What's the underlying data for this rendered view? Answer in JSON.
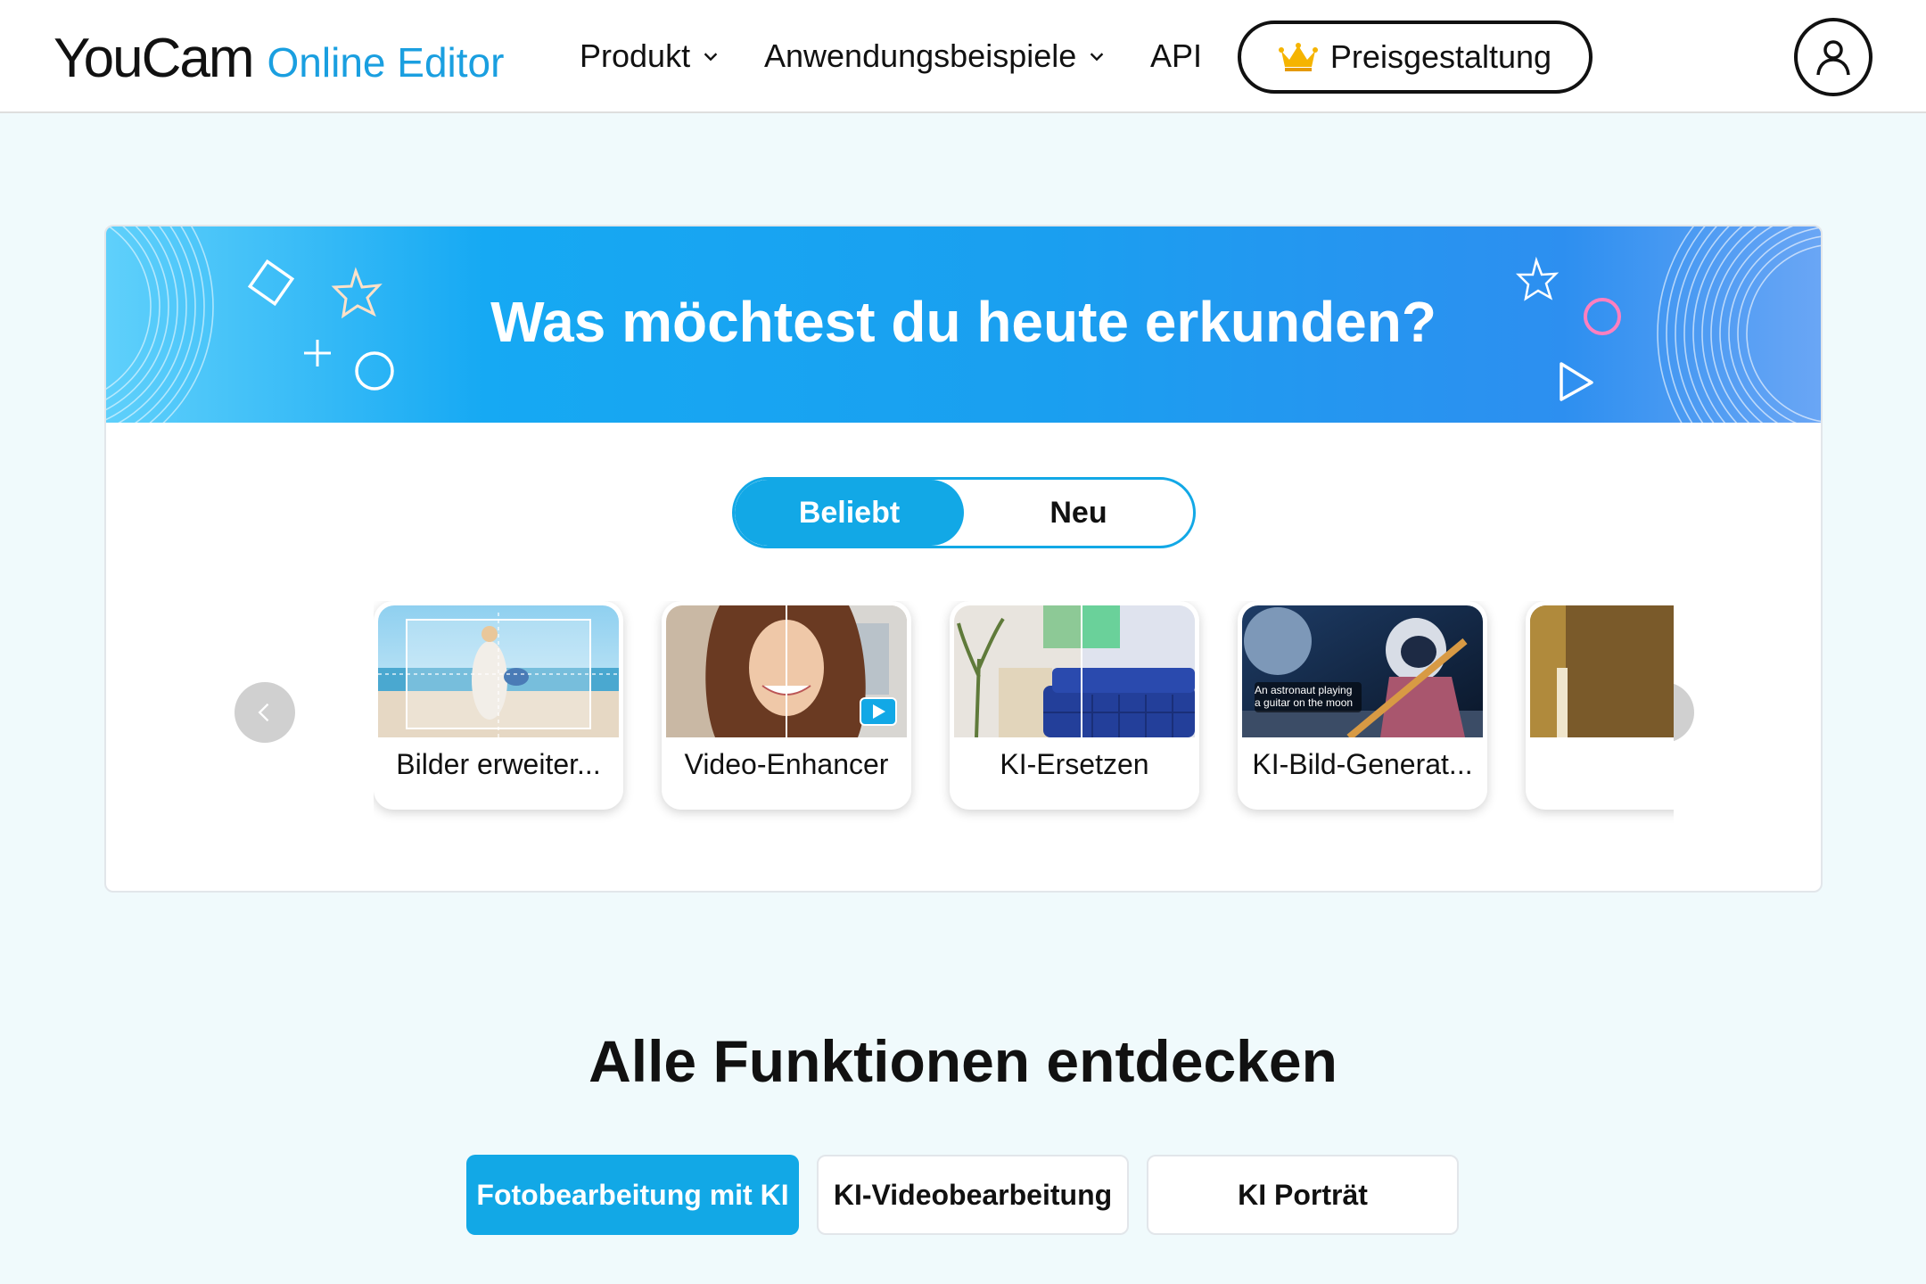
{
  "header": {
    "logo_main": "YouCam",
    "logo_sub": "Online Editor",
    "nav": {
      "produkt": "Produkt",
      "beispiele": "Anwendungsbeispiele",
      "api": "API"
    },
    "pricing_label": "Preisgestaltung",
    "icons": {
      "pricing": "crown-icon",
      "user": "user-icon"
    }
  },
  "explore": {
    "banner_title": "Was möchtest du heute erkunden?",
    "tabs": [
      {
        "label": "Beliebt",
        "active": true
      },
      {
        "label": "Neu",
        "active": false
      }
    ],
    "tools": [
      {
        "label": "Bilder erweiter..."
      },
      {
        "label": "Video-Enhancer"
      },
      {
        "label": "KI-Ersetzen"
      },
      {
        "label": "KI-Bild-Generat..."
      },
      {
        "label": ""
      }
    ],
    "thumb_caption": "An astronaut playing\na guitar on the moon"
  },
  "section": {
    "title": "Alle Funktionen entdecken",
    "categories": [
      {
        "label": "Fotobearbeitung mit KI",
        "active": true
      },
      {
        "label": "KI-Videobearbeitung",
        "active": false
      },
      {
        "label": "KI Porträt",
        "active": false
      }
    ]
  },
  "colors": {
    "accent": "#12a8e6",
    "logo_sub": "#1a9fe0",
    "page_bg": "#f0fafc"
  }
}
